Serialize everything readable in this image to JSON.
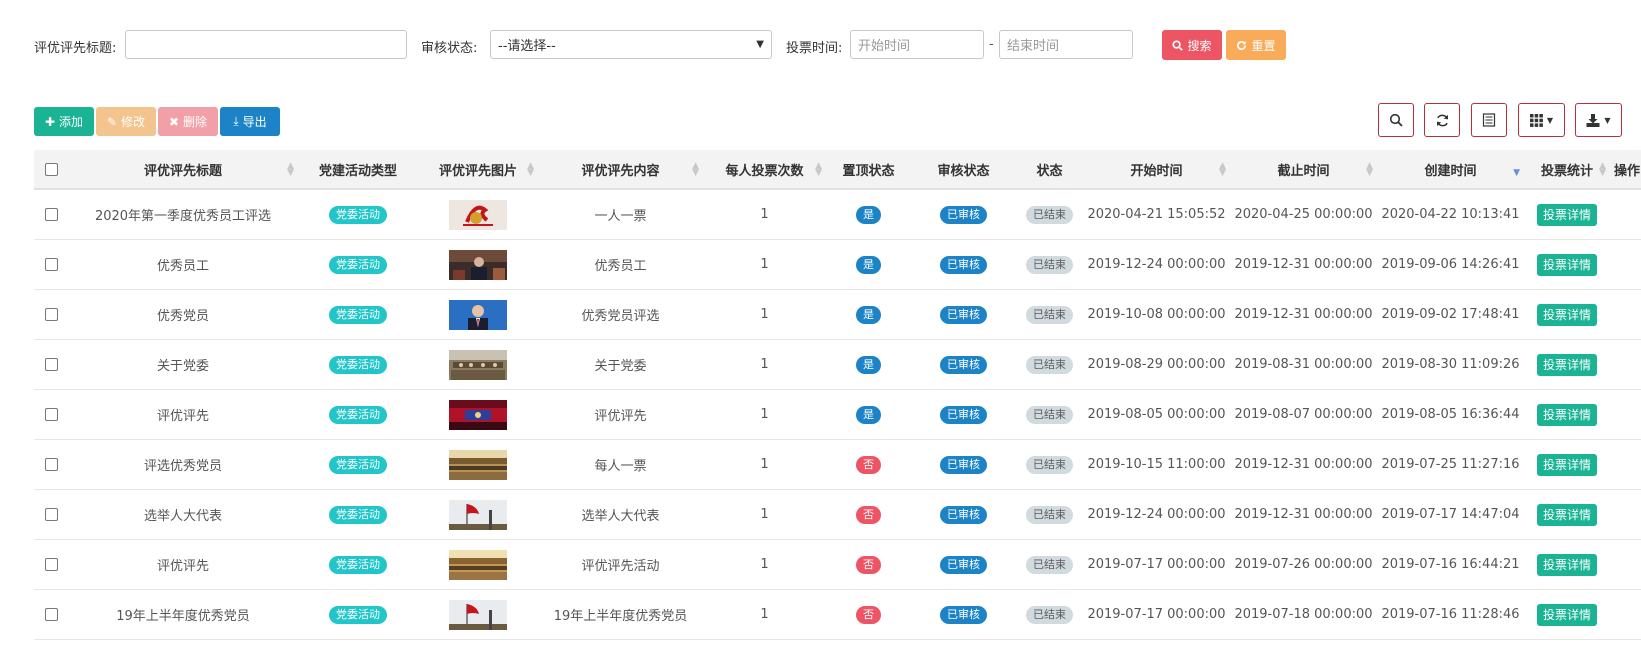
{
  "search": {
    "title_label": "评优评先标题:",
    "title_value": "",
    "audit_label": "审核状态:",
    "audit_selected": "--请选择--",
    "vote_time_label": "投票时间:",
    "start_placeholder": "开始时间",
    "end_placeholder": "结束时间",
    "range_separator": "-",
    "search_button": "搜索",
    "reset_button": "重置"
  },
  "toolbar": {
    "add": "添加",
    "edit": "修改",
    "delete": "删除",
    "export": "导出",
    "icons": [
      "search-icon",
      "refresh-icon",
      "list-icon",
      "columns-icon",
      "download-icon"
    ]
  },
  "table": {
    "columns": [
      "评优评先标题",
      "党建活动类型",
      "评优评先图片",
      "评优评先内容",
      "每人投票次数",
      "置顶状态",
      "审核状态",
      "状态",
      "开始时间",
      "截止时间",
      "创建时间",
      "投票统计",
      "操作"
    ],
    "rows": [
      {
        "title": "2020年第一季度优秀员工评选",
        "type": "党委活动",
        "content": "一人一票",
        "votes": "1",
        "top": "是",
        "audit": "已审核",
        "status": "已结束",
        "start": "2020-04-21 15:05:52",
        "end": "2020-04-25 00:00:00",
        "created": "2020-04-22 10:13:41",
        "stat": "投票详情"
      },
      {
        "title": "优秀员工",
        "type": "党委活动",
        "content": "优秀员工",
        "votes": "1",
        "top": "是",
        "audit": "已审核",
        "status": "已结束",
        "start": "2019-12-24 00:00:00",
        "end": "2019-12-31 00:00:00",
        "created": "2019-09-06 14:26:41",
        "stat": "投票详情"
      },
      {
        "title": "优秀党员",
        "type": "党委活动",
        "content": "优秀党员评选",
        "votes": "1",
        "top": "是",
        "audit": "已审核",
        "status": "已结束",
        "start": "2019-10-08 00:00:00",
        "end": "2019-12-31 00:00:00",
        "created": "2019-09-02 17:48:41",
        "stat": "投票详情"
      },
      {
        "title": "关于党委",
        "type": "党委活动",
        "content": "关于党委",
        "votes": "1",
        "top": "是",
        "audit": "已审核",
        "status": "已结束",
        "start": "2019-08-29 00:00:00",
        "end": "2019-08-31 00:00:00",
        "created": "2019-08-30 11:09:26",
        "stat": "投票详情"
      },
      {
        "title": "评优评先",
        "type": "党委活动",
        "content": "评优评先",
        "votes": "1",
        "top": "是",
        "audit": "已审核",
        "status": "已结束",
        "start": "2019-08-05 00:00:00",
        "end": "2019-08-07 00:00:00",
        "created": "2019-08-05 16:36:44",
        "stat": "投票详情"
      },
      {
        "title": "评选优秀党员",
        "type": "党委活动",
        "content": "每人一票",
        "votes": "1",
        "top": "否",
        "audit": "已审核",
        "status": "已结束",
        "start": "2019-10-15 11:00:00",
        "end": "2019-12-31 00:00:00",
        "created": "2019-07-25 11:27:16",
        "stat": "投票详情"
      },
      {
        "title": "选举人大代表",
        "type": "党委活动",
        "content": "选举人大代表",
        "votes": "1",
        "top": "否",
        "audit": "已审核",
        "status": "已结束",
        "start": "2019-12-24 00:00:00",
        "end": "2019-12-31 00:00:00",
        "created": "2019-07-17 14:47:04",
        "stat": "投票详情"
      },
      {
        "title": "评优评先",
        "type": "党委活动",
        "content": "评优评先活动",
        "votes": "1",
        "top": "否",
        "audit": "已审核",
        "status": "已结束",
        "start": "2019-07-17 00:00:00",
        "end": "2019-07-26 00:00:00",
        "created": "2019-07-16 16:44:21",
        "stat": "投票详情"
      },
      {
        "title": "19年上半年度优秀党员",
        "type": "党委活动",
        "content": "19年上半年度优秀党员",
        "votes": "1",
        "top": "否",
        "audit": "已审核",
        "status": "已结束",
        "start": "2019-07-17 00:00:00",
        "end": "2019-07-18 00:00:00",
        "created": "2019-07-16 11:28:46",
        "stat": "投票详情"
      }
    ]
  },
  "colors": {
    "primary": "#1ab394",
    "danger": "#ed5565",
    "warning": "#f8ac59",
    "info": "#23c6c8",
    "blue": "#1c84c6"
  }
}
